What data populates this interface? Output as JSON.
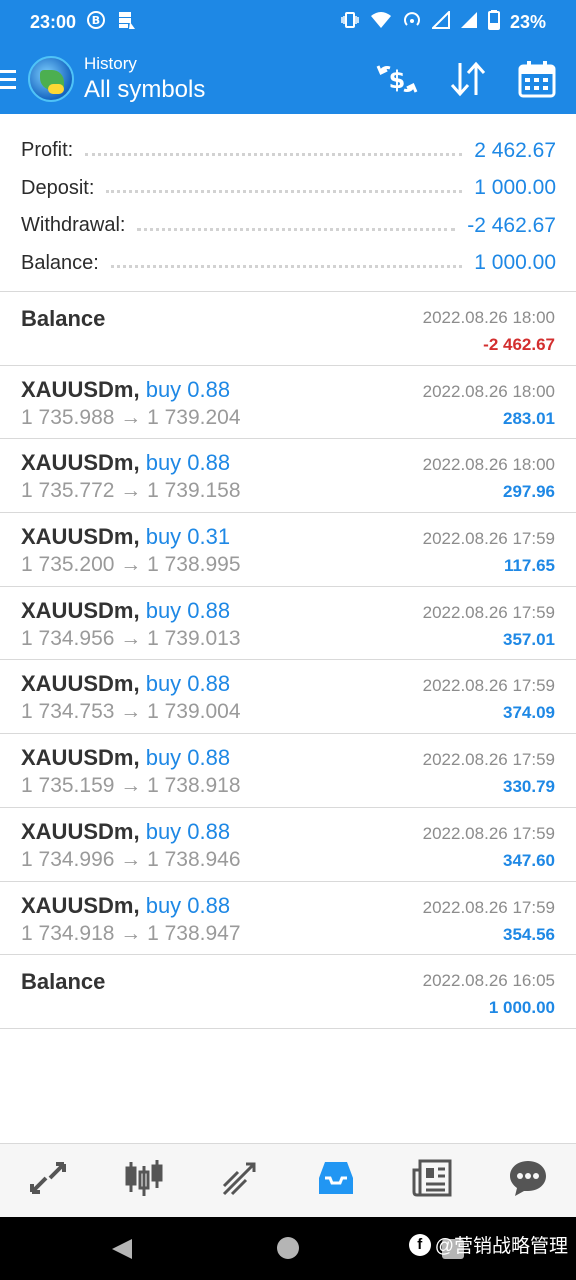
{
  "status_bar": {
    "time": "23:00",
    "battery": "23%",
    "left_icons": [
      "b-icon",
      "storage-icon"
    ],
    "right_icons": [
      "vibrate-icon",
      "wifi-icon",
      "hotspot-icon",
      "signal-icon",
      "signal-icon",
      "battery-icon"
    ]
  },
  "app_bar": {
    "subtitle": "History",
    "title": "All symbols"
  },
  "summary": [
    {
      "label": "Profit:",
      "value": "2 462.67"
    },
    {
      "label": "Deposit:",
      "value": "1 000.00"
    },
    {
      "label": "Withdrawal:",
      "value": "-2 462.67"
    },
    {
      "label": "Balance:",
      "value": "1 000.00"
    }
  ],
  "deals": [
    {
      "type": "balance",
      "symbol": "Balance",
      "datetime": "2022.08.26 18:00",
      "profit": "-2 462.67",
      "negative": true
    },
    {
      "type": "trade",
      "symbol": "XAUUSDm,",
      "action": "buy 0.88",
      "prices": "1 735.988 → 1 739.204",
      "datetime": "2022.08.26 18:00",
      "profit": "283.01"
    },
    {
      "type": "trade",
      "symbol": "XAUUSDm,",
      "action": "buy 0.88",
      "prices": "1 735.772 → 1 739.158",
      "datetime": "2022.08.26 18:00",
      "profit": "297.96"
    },
    {
      "type": "trade",
      "symbol": "XAUUSDm,",
      "action": "buy 0.31",
      "prices": "1 735.200 → 1 738.995",
      "datetime": "2022.08.26 17:59",
      "profit": "117.65"
    },
    {
      "type": "trade",
      "symbol": "XAUUSDm,",
      "action": "buy 0.88",
      "prices": "1 734.956 → 1 739.013",
      "datetime": "2022.08.26 17:59",
      "profit": "357.01"
    },
    {
      "type": "trade",
      "symbol": "XAUUSDm,",
      "action": "buy 0.88",
      "prices": "1 734.753 → 1 739.004",
      "datetime": "2022.08.26 17:59",
      "profit": "374.09"
    },
    {
      "type": "trade",
      "symbol": "XAUUSDm,",
      "action": "buy 0.88",
      "prices": "1 735.159 → 1 738.918",
      "datetime": "2022.08.26 17:59",
      "profit": "330.79"
    },
    {
      "type": "trade",
      "symbol": "XAUUSDm,",
      "action": "buy 0.88",
      "prices": "1 734.996 → 1 738.946",
      "datetime": "2022.08.26 17:59",
      "profit": "347.60"
    },
    {
      "type": "trade",
      "symbol": "XAUUSDm,",
      "action": "buy 0.88",
      "prices": "1 734.918 → 1 738.947",
      "datetime": "2022.08.26 17:59",
      "profit": "354.56"
    },
    {
      "type": "balance",
      "symbol": "Balance",
      "datetime": "2022.08.26 16:05",
      "profit": "1 000.00",
      "negative": false
    }
  ],
  "bottom_nav": [
    {
      "name": "quotes",
      "icon": "quotes-icon"
    },
    {
      "name": "chart",
      "icon": "candlestick-chart-icon"
    },
    {
      "name": "trade",
      "icon": "trade-icon"
    },
    {
      "name": "history",
      "icon": "inbox-icon",
      "active": true
    },
    {
      "name": "news",
      "icon": "news-icon"
    },
    {
      "name": "chat",
      "icon": "chat-icon"
    }
  ],
  "watermark": {
    "text": "@营销战略管理"
  },
  "colors": {
    "accent": "#1e88e5",
    "negative": "#d32f2f",
    "active_nav": "#2196f3",
    "inactive_nav": "#555555"
  }
}
